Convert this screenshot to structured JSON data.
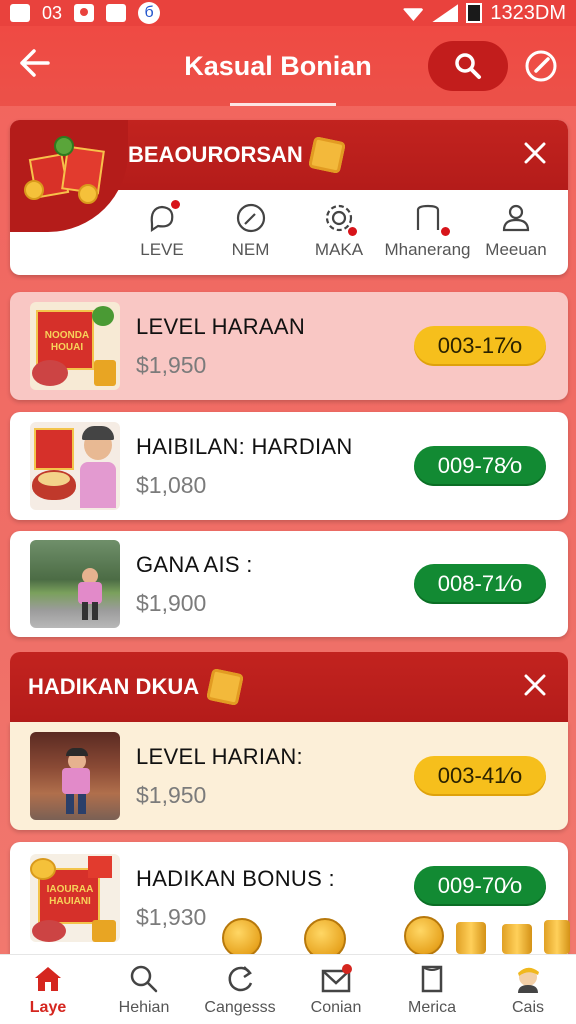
{
  "status_bar": {
    "left_text_1": "03",
    "left_text_2": "б",
    "time": "1323DM"
  },
  "app_bar": {
    "title": "Kasual Bonian"
  },
  "section1": {
    "title": "BEAOURORSAN",
    "categories": [
      {
        "label": "LEVE",
        "icon": "chat-bubble-icon",
        "has_dot": true
      },
      {
        "label": "NEM",
        "icon": "compass-icon",
        "has_dot": false
      },
      {
        "label": "MAKA",
        "icon": "gear-icon",
        "has_dot": true
      },
      {
        "label": "Mhanerang",
        "icon": "bookmark-icon",
        "has_dot": true
      },
      {
        "label": "Meeuan",
        "icon": "person-icon",
        "has_dot": false
      }
    ]
  },
  "cards": [
    {
      "title": "LEVEL HARAAN",
      "amount": "$1,950",
      "pill": "003-17⁄o",
      "pill_color": "yellow",
      "thumb_text_1": "NOONDA",
      "thumb_text_2": "HOUAI"
    },
    {
      "title": "HAIBILAN: HARDIAN",
      "amount": "$1,080",
      "pill": "009-78⁄o",
      "pill_color": "green"
    },
    {
      "title": "GANA AIS :",
      "amount": "$1,900",
      "pill": "008-71⁄o",
      "pill_color": "green"
    }
  ],
  "section2": {
    "title": "HADIKAN DKUA",
    "card": {
      "title": "LEVEL HARIAN:",
      "amount": "$1,950",
      "pill": "003-41⁄o",
      "pill_color": "yellow"
    }
  },
  "card_last": {
    "title": "HADIKAN BONUS :",
    "amount": "$1,930",
    "pill": "009-70⁄o",
    "pill_color": "green",
    "thumb_text_1": "IAOURAA",
    "thumb_text_2": "HAUIANI"
  },
  "bottom_nav": [
    {
      "label": "Laye",
      "icon": "home-icon",
      "active": true
    },
    {
      "label": "Hehian",
      "icon": "search-icon",
      "active": false
    },
    {
      "label": "Cangesss",
      "icon": "refresh-icon",
      "active": false
    },
    {
      "label": "Conian",
      "icon": "mail-icon",
      "active": false
    },
    {
      "label": "Merica",
      "icon": "book-icon",
      "active": false
    },
    {
      "label": "Cais",
      "icon": "avatar-icon",
      "active": false
    }
  ],
  "colors": {
    "primary_red": "#e9423d",
    "dark_red": "#b41c1a",
    "yellow": "#f6bf1c",
    "green": "#128a33"
  }
}
